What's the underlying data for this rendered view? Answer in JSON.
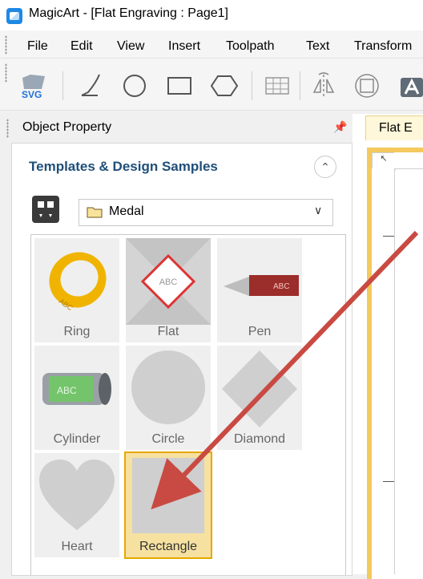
{
  "window": {
    "title": "MagicArt - [Flat Engraving : Page1]"
  },
  "menu": [
    {
      "label": "File"
    },
    {
      "label": "Edit"
    },
    {
      "label": "View"
    },
    {
      "label": "Insert"
    },
    {
      "label": "Toolpath"
    },
    {
      "label": "Text"
    },
    {
      "label": "Transform"
    }
  ],
  "toolbar": {
    "svg_label": "SVG"
  },
  "panel": {
    "title": "Object Property",
    "section_title": "Templates & Design Samples",
    "folder": "Medal"
  },
  "templates": [
    {
      "label": "Ring"
    },
    {
      "label": "Flat"
    },
    {
      "label": "Pen"
    },
    {
      "label": "Cylinder"
    },
    {
      "label": "Circle"
    },
    {
      "label": "Diamond"
    },
    {
      "label": "Heart"
    },
    {
      "label": "Rectangle"
    }
  ],
  "badges": {
    "abc": "ABC"
  },
  "document": {
    "tab_label": "Flat E"
  },
  "colors": {
    "accent": "#1f4e79",
    "arrow": "#c94a42",
    "selected_bg": "#f6e1a1",
    "selected_border": "#e6a800"
  }
}
